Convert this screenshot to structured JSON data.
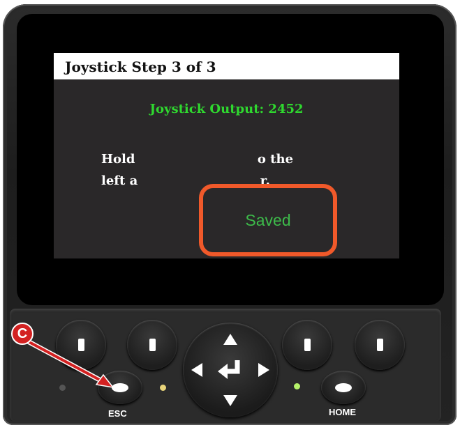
{
  "screen": {
    "title": "Joystick Step 3 of 3",
    "output_label": "Joystick Output: 2452",
    "instruction_line1": "Hold                            o the",
    "instruction_line2": "left a                            r.",
    "popup_text": "Saved"
  },
  "keypad": {
    "esc_label": "ESC",
    "home_label": "HOME",
    "soft_keys": [
      "soft-key-1",
      "soft-key-2",
      "soft-key-3",
      "soft-key-4"
    ],
    "dpad_icons": [
      "arrow-up-icon",
      "arrow-left-icon",
      "enter-icon",
      "arrow-right-icon",
      "arrow-down-icon"
    ]
  },
  "annotation": {
    "callout_letter": "C"
  },
  "colors": {
    "output_text": "#2fd82f",
    "popup_border": "#f0592a",
    "popup_text": "#3dba4a",
    "callout": "#d32121",
    "led_amber": "#e8d47a",
    "led_green": "#b6f26a"
  }
}
